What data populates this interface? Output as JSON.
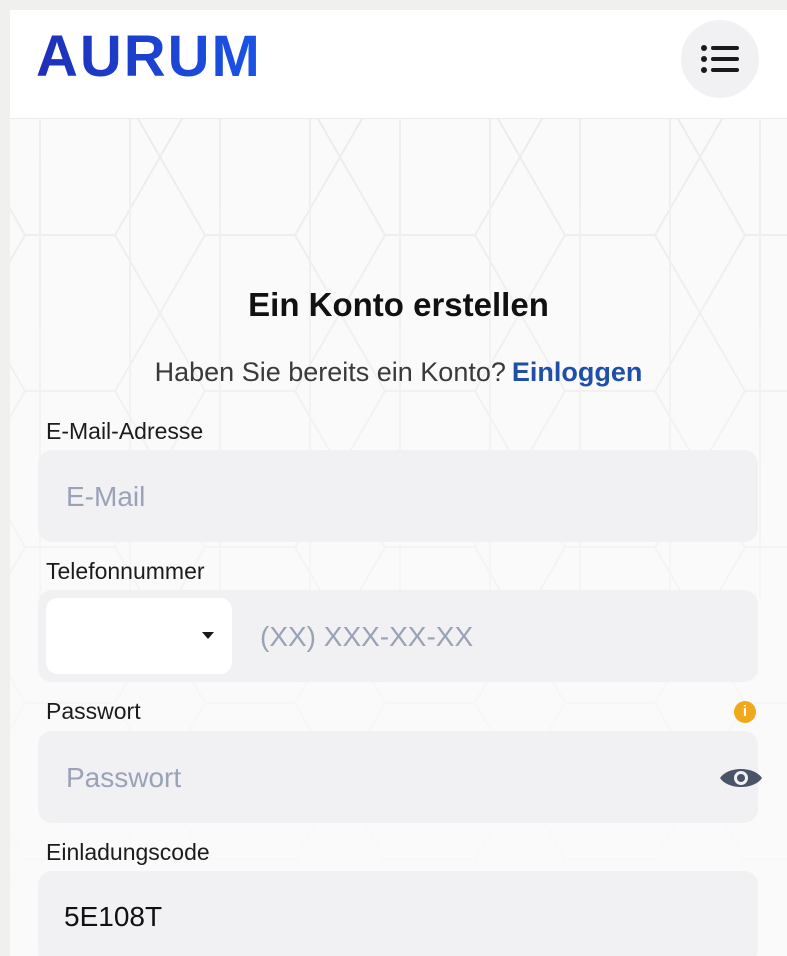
{
  "header": {
    "logo_text": "AURUM",
    "brand_color": "#1a3fd6",
    "menu_icon": "hamburger-list-icon"
  },
  "signup": {
    "title": "Ein Konto erstellen",
    "have_account_text": "Haben Sie bereits ein Konto?",
    "login_link": "Einloggen",
    "link_color": "#1f4fa8"
  },
  "form": {
    "email": {
      "label": "E-Mail-Adresse",
      "placeholder": "E-Mail",
      "value": ""
    },
    "phone": {
      "label": "Telefonnummer",
      "placeholder": "(XX) XXX-XX-XX",
      "value": "",
      "country_value": ""
    },
    "password": {
      "label": "Passwort",
      "placeholder": "Passwort",
      "value": "",
      "info_icon": "info-icon",
      "info_color": "#f0a91c",
      "toggle_icon": "eye-icon"
    },
    "invite": {
      "label": "Einladungscode",
      "value": "5E108T"
    }
  }
}
